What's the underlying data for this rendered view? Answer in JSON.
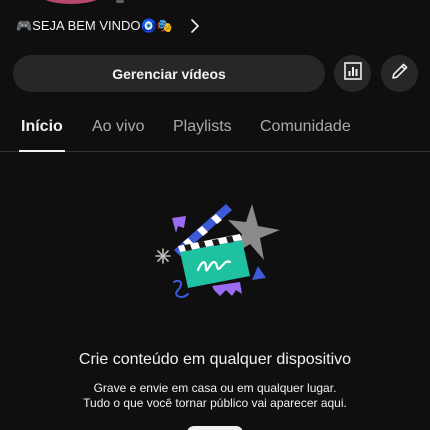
{
  "channel": {
    "description": "🎮SEJA BEM VINDO🧿🎭"
  },
  "actions": {
    "manage_videos_label": "Gerenciar vídeos"
  },
  "tabs": [
    {
      "label": "Início",
      "active": true
    },
    {
      "label": "Ao vivo",
      "active": false
    },
    {
      "label": "Playlists",
      "active": false
    },
    {
      "label": "Comunidade",
      "active": false
    }
  ],
  "empty_state": {
    "title": "Crie conteúdo em qualquer dispositivo",
    "subtitle_line1": "Grave e envie em casa ou em qualquer lugar.",
    "subtitle_line2": "Tudo o que você tornar público vai aparecer aqui."
  },
  "icons": {
    "stats": "bar-chart-icon",
    "edit": "pencil-icon",
    "chevron": "chevron-right-icon",
    "illustration": "clapperboard-illustration"
  },
  "colors": {
    "background": "#0f0f0f",
    "button_bg": "#272727",
    "text": "#f1f1f1",
    "muted_text": "#aaaaaa",
    "accent_teal": "#1ec2a0",
    "accent_blue": "#3b5bdb",
    "accent_purple": "#9b6bf2"
  }
}
